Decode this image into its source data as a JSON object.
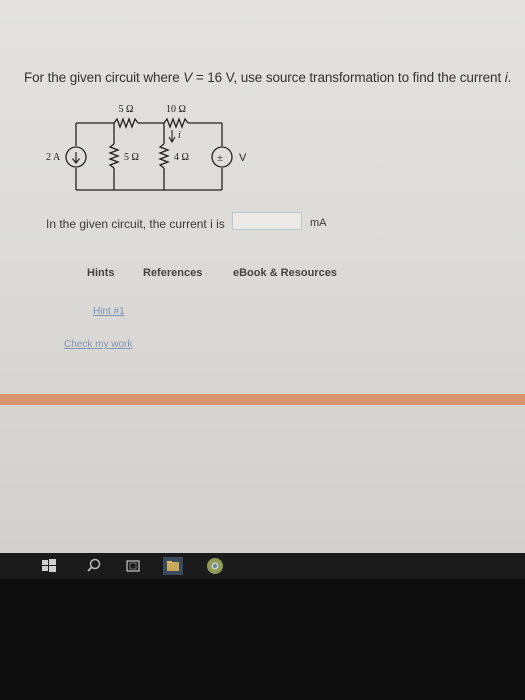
{
  "question": {
    "prefix": "For the given circuit where ",
    "var_v": "V",
    "middle": " = 16 V, use source transformation to find the current ",
    "var_i": "i",
    "suffix": "."
  },
  "circuit": {
    "r_top_left": "5 Ω",
    "r_top_right": "10 Ω",
    "r_mid": "5 Ω",
    "r_right": "4 Ω",
    "current_source": "2 A",
    "current_label": "i",
    "voltage_label": "V",
    "polarity": "±"
  },
  "answer": {
    "prompt": "In the given circuit, the current i is",
    "value": "",
    "unit": "mA"
  },
  "tabs": {
    "hints": "Hints",
    "references": "References",
    "ebook": "eBook & Resources"
  },
  "links": {
    "hint": "Hint #1",
    "check": "Check my work"
  },
  "colors": {
    "accent_bar": "#d99572",
    "link": "#7d93b8",
    "taskbar": "#1b1b1b"
  },
  "taskbar": {
    "icons": [
      "windows-start-icon",
      "search-icon",
      "task-view-icon",
      "file-explorer-icon",
      "chrome-icon"
    ]
  }
}
